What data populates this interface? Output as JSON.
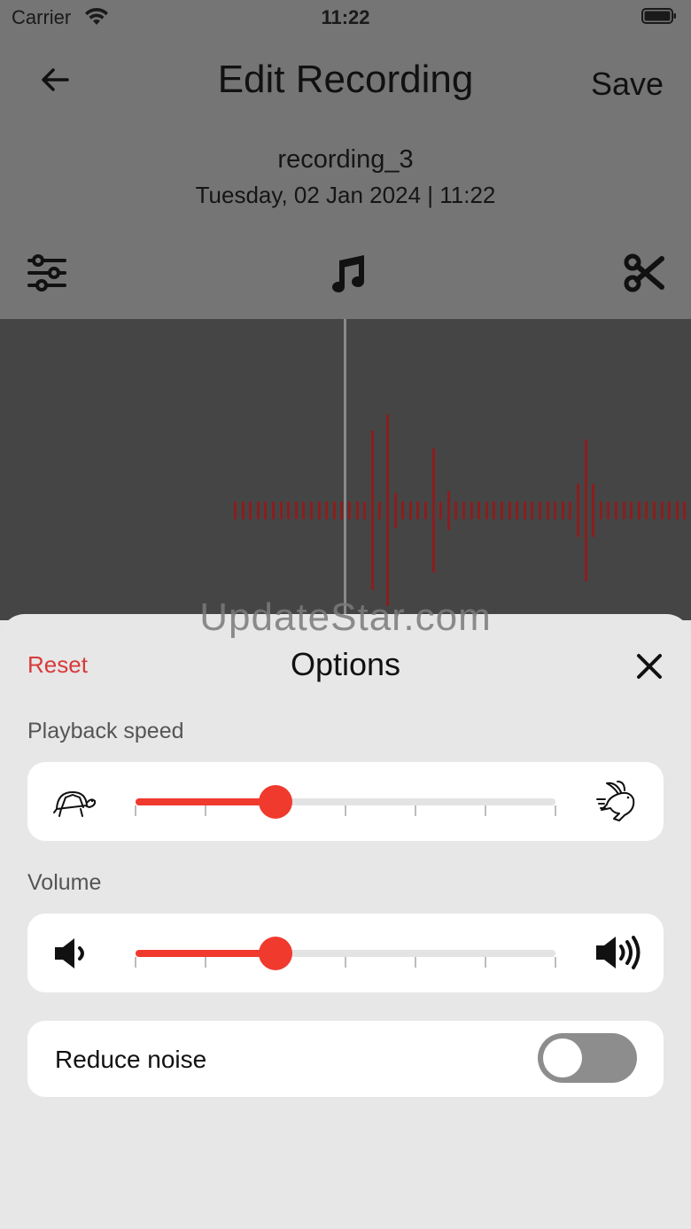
{
  "status": {
    "carrier": "Carrier",
    "time": "11:22"
  },
  "header": {
    "title": "Edit Recording",
    "save_label": "Save"
  },
  "recording": {
    "name": "recording_3",
    "datetime": "Tuesday, 02 Jan 2024 | 11:22"
  },
  "toolbar": {
    "icons": [
      "sliders-icon",
      "music-note-icon",
      "scissors-icon"
    ]
  },
  "waveform": {
    "color": "#8b1e1e"
  },
  "watermark": "UpdateStar.com",
  "options": {
    "reset_label": "Reset",
    "title": "Options",
    "playback_speed": {
      "label": "Playback speed",
      "level": 0.333,
      "steps": 6
    },
    "volume": {
      "label": "Volume",
      "level": 0.333,
      "steps": 6
    },
    "reduce_noise": {
      "label": "Reduce noise",
      "enabled": false
    }
  },
  "colors": {
    "accent": "#f03a2e",
    "reset": "#d83a3a",
    "toggle_off": "#8d8d8d"
  }
}
